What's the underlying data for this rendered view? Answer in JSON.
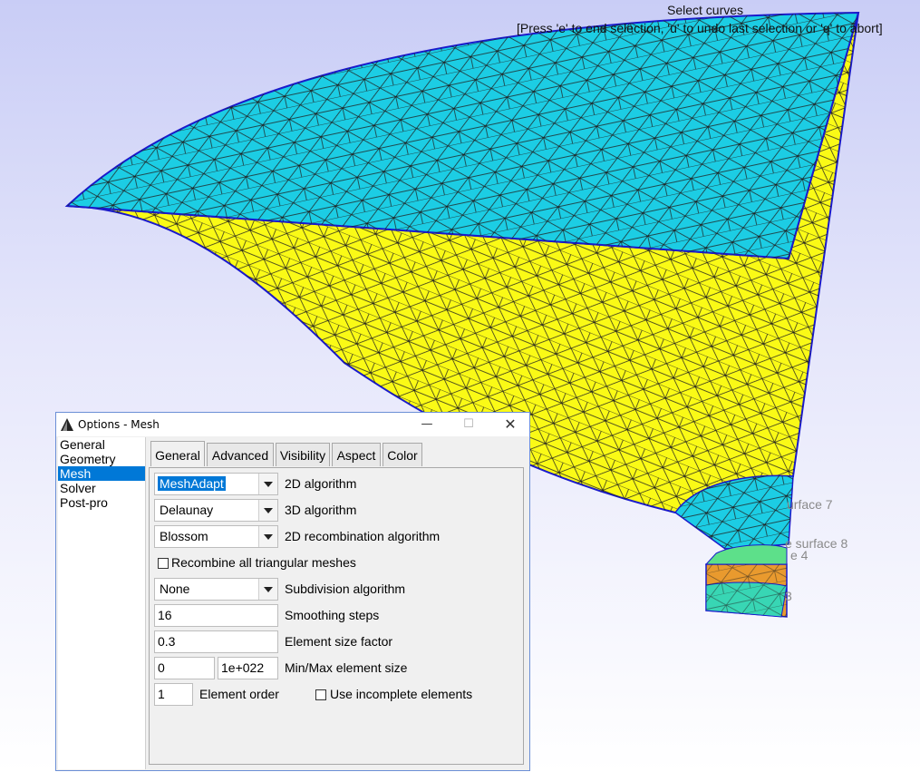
{
  "viewport": {
    "status_title": "Select curves",
    "status_hint": "[Press 'e' to end selection, 'u' to undo last selection or 'q' to abort]",
    "surface_labels": [
      "urface 7",
      "e surface 8",
      "e 4",
      "3"
    ],
    "colors": {
      "cyan_surface": "#1ccde4",
      "yellow_surface": "#fafa16",
      "orange_surface": "#e99a2e",
      "edge": "#1a1acc"
    }
  },
  "dialog": {
    "title": "Options - Mesh",
    "window_buttons": {
      "minimize": "—",
      "maximize": "☐",
      "close": "✕"
    },
    "categories": [
      "General",
      "Geometry",
      "Mesh",
      "Solver",
      "Post-pro"
    ],
    "selected_category": "Mesh",
    "tabs": [
      "General",
      "Advanced",
      "Visibility",
      "Aspect",
      "Color"
    ],
    "active_tab": "General",
    "general": {
      "algo2d": {
        "value": "MeshAdapt",
        "label": "2D algorithm"
      },
      "algo3d": {
        "value": "Delaunay",
        "label": "3D algorithm"
      },
      "recomb": {
        "value": "Blossom",
        "label": "2D recombination algorithm"
      },
      "recombine_all": {
        "label": "Recombine all triangular meshes",
        "checked": false
      },
      "subdiv": {
        "value": "None",
        "label": "Subdivision algorithm"
      },
      "smoothing": {
        "value": "16",
        "label": "Smoothing steps"
      },
      "size_factor": {
        "value": "0.3",
        "label": "Element size factor"
      },
      "minmax": {
        "min": "0",
        "max": "1e+022",
        "label": "Min/Max element size"
      },
      "order": {
        "value": "1",
        "label": "Element order"
      },
      "incomplete": {
        "label": "Use incomplete elements",
        "checked": false
      }
    }
  }
}
